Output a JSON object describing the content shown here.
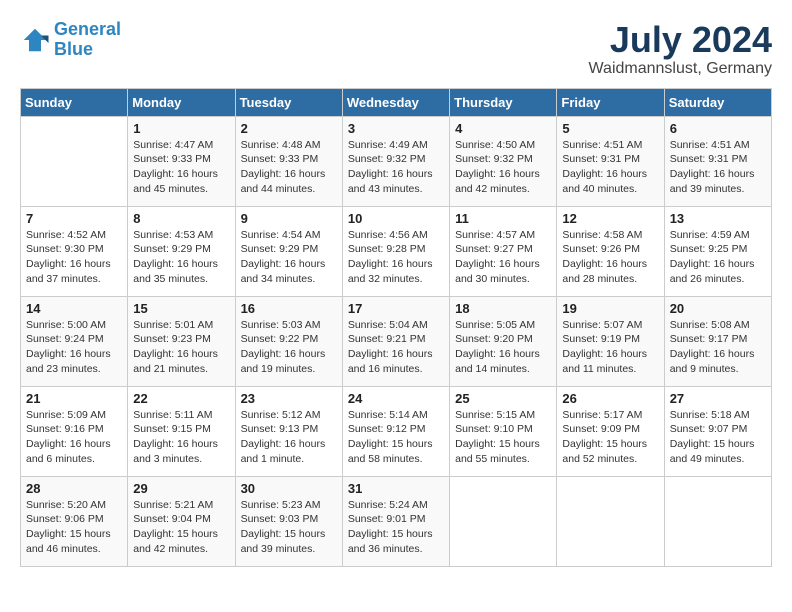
{
  "header": {
    "logo_line1": "General",
    "logo_line2": "Blue",
    "title": "July 2024",
    "subtitle": "Waidmannslust, Germany"
  },
  "weekdays": [
    "Sunday",
    "Monday",
    "Tuesday",
    "Wednesday",
    "Thursday",
    "Friday",
    "Saturday"
  ],
  "weeks": [
    [
      {
        "day": "",
        "info": ""
      },
      {
        "day": "1",
        "info": "Sunrise: 4:47 AM\nSunset: 9:33 PM\nDaylight: 16 hours\nand 45 minutes."
      },
      {
        "day": "2",
        "info": "Sunrise: 4:48 AM\nSunset: 9:33 PM\nDaylight: 16 hours\nand 44 minutes."
      },
      {
        "day": "3",
        "info": "Sunrise: 4:49 AM\nSunset: 9:32 PM\nDaylight: 16 hours\nand 43 minutes."
      },
      {
        "day": "4",
        "info": "Sunrise: 4:50 AM\nSunset: 9:32 PM\nDaylight: 16 hours\nand 42 minutes."
      },
      {
        "day": "5",
        "info": "Sunrise: 4:51 AM\nSunset: 9:31 PM\nDaylight: 16 hours\nand 40 minutes."
      },
      {
        "day": "6",
        "info": "Sunrise: 4:51 AM\nSunset: 9:31 PM\nDaylight: 16 hours\nand 39 minutes."
      }
    ],
    [
      {
        "day": "7",
        "info": "Sunrise: 4:52 AM\nSunset: 9:30 PM\nDaylight: 16 hours\nand 37 minutes."
      },
      {
        "day": "8",
        "info": "Sunrise: 4:53 AM\nSunset: 9:29 PM\nDaylight: 16 hours\nand 35 minutes."
      },
      {
        "day": "9",
        "info": "Sunrise: 4:54 AM\nSunset: 9:29 PM\nDaylight: 16 hours\nand 34 minutes."
      },
      {
        "day": "10",
        "info": "Sunrise: 4:56 AM\nSunset: 9:28 PM\nDaylight: 16 hours\nand 32 minutes."
      },
      {
        "day": "11",
        "info": "Sunrise: 4:57 AM\nSunset: 9:27 PM\nDaylight: 16 hours\nand 30 minutes."
      },
      {
        "day": "12",
        "info": "Sunrise: 4:58 AM\nSunset: 9:26 PM\nDaylight: 16 hours\nand 28 minutes."
      },
      {
        "day": "13",
        "info": "Sunrise: 4:59 AM\nSunset: 9:25 PM\nDaylight: 16 hours\nand 26 minutes."
      }
    ],
    [
      {
        "day": "14",
        "info": "Sunrise: 5:00 AM\nSunset: 9:24 PM\nDaylight: 16 hours\nand 23 minutes."
      },
      {
        "day": "15",
        "info": "Sunrise: 5:01 AM\nSunset: 9:23 PM\nDaylight: 16 hours\nand 21 minutes."
      },
      {
        "day": "16",
        "info": "Sunrise: 5:03 AM\nSunset: 9:22 PM\nDaylight: 16 hours\nand 19 minutes."
      },
      {
        "day": "17",
        "info": "Sunrise: 5:04 AM\nSunset: 9:21 PM\nDaylight: 16 hours\nand 16 minutes."
      },
      {
        "day": "18",
        "info": "Sunrise: 5:05 AM\nSunset: 9:20 PM\nDaylight: 16 hours\nand 14 minutes."
      },
      {
        "day": "19",
        "info": "Sunrise: 5:07 AM\nSunset: 9:19 PM\nDaylight: 16 hours\nand 11 minutes."
      },
      {
        "day": "20",
        "info": "Sunrise: 5:08 AM\nSunset: 9:17 PM\nDaylight: 16 hours\nand 9 minutes."
      }
    ],
    [
      {
        "day": "21",
        "info": "Sunrise: 5:09 AM\nSunset: 9:16 PM\nDaylight: 16 hours\nand 6 minutes."
      },
      {
        "day": "22",
        "info": "Sunrise: 5:11 AM\nSunset: 9:15 PM\nDaylight: 16 hours\nand 3 minutes."
      },
      {
        "day": "23",
        "info": "Sunrise: 5:12 AM\nSunset: 9:13 PM\nDaylight: 16 hours\nand 1 minute."
      },
      {
        "day": "24",
        "info": "Sunrise: 5:14 AM\nSunset: 9:12 PM\nDaylight: 15 hours\nand 58 minutes."
      },
      {
        "day": "25",
        "info": "Sunrise: 5:15 AM\nSunset: 9:10 PM\nDaylight: 15 hours\nand 55 minutes."
      },
      {
        "day": "26",
        "info": "Sunrise: 5:17 AM\nSunset: 9:09 PM\nDaylight: 15 hours\nand 52 minutes."
      },
      {
        "day": "27",
        "info": "Sunrise: 5:18 AM\nSunset: 9:07 PM\nDaylight: 15 hours\nand 49 minutes."
      }
    ],
    [
      {
        "day": "28",
        "info": "Sunrise: 5:20 AM\nSunset: 9:06 PM\nDaylight: 15 hours\nand 46 minutes."
      },
      {
        "day": "29",
        "info": "Sunrise: 5:21 AM\nSunset: 9:04 PM\nDaylight: 15 hours\nand 42 minutes."
      },
      {
        "day": "30",
        "info": "Sunrise: 5:23 AM\nSunset: 9:03 PM\nDaylight: 15 hours\nand 39 minutes."
      },
      {
        "day": "31",
        "info": "Sunrise: 5:24 AM\nSunset: 9:01 PM\nDaylight: 15 hours\nand 36 minutes."
      },
      {
        "day": "",
        "info": ""
      },
      {
        "day": "",
        "info": ""
      },
      {
        "day": "",
        "info": ""
      }
    ]
  ]
}
